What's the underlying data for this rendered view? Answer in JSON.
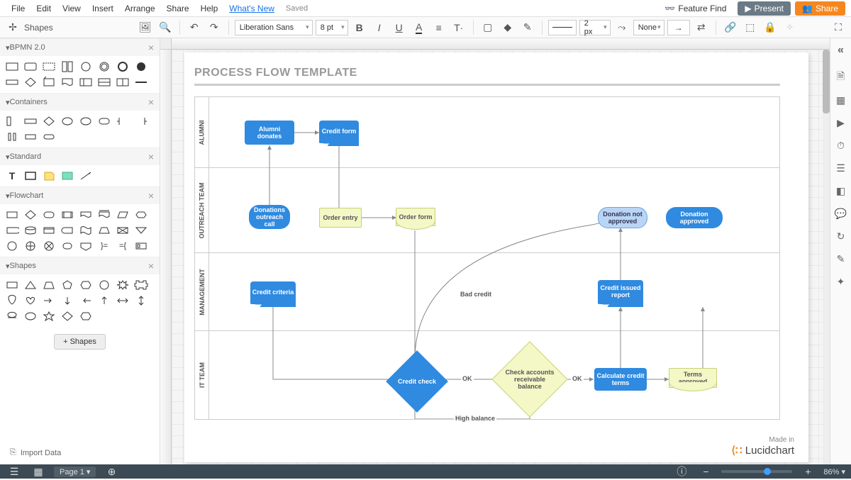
{
  "menubar": {
    "items": [
      "File",
      "Edit",
      "View",
      "Insert",
      "Arrange",
      "Share",
      "Help"
    ],
    "whats_new": "What's New",
    "saved": "Saved",
    "feature_find": "Feature Find",
    "present": "Present",
    "share": "Share"
  },
  "toolbar": {
    "font_family": "Liberation Sans",
    "font_size": "8 pt",
    "line_width": "2 px",
    "fill": "None"
  },
  "left_panel": {
    "header": "Shapes",
    "sections": {
      "bpmn": "BPMN 2.0",
      "containers": "Containers",
      "standard": "Standard",
      "flowchart": "Flowchart",
      "shapes": "Shapes"
    },
    "add_shapes": "+  Shapes",
    "import_data": "Import Data"
  },
  "diagram": {
    "title": "PROCESS FLOW TEMPLATE",
    "swimlanes": [
      "ALUMNI",
      "OUTREACH TEAM",
      "MANAGEMENT",
      "IT TEAM"
    ],
    "nodes": {
      "alumni_donates": "Alumni donates",
      "credit_form": "Credit form",
      "donations_outreach_call": "Donations outreach call",
      "order_entry": "Order entry",
      "order_form": "Order form",
      "donation_not_approved": "Donation not approved",
      "donation_approved": "Donation approved",
      "credit_criteria": "Credit criteria",
      "bad_credit": "Bad credit",
      "credit_issued_report": "Credit issued report",
      "credit_check": "Credit check",
      "check_accounts": "Check accounts receivable balance",
      "calculate_credit_terms": "Calculate credit terms",
      "terms_approved": "Terms approved"
    },
    "edge_labels": {
      "ok1": "OK",
      "ok2": "OK",
      "high_balance": "High balance"
    },
    "made_in": "Made in",
    "brand": "Lucidchart"
  },
  "bottom_bar": {
    "page_tab": "Page 1 ▾",
    "zoom": "86% ▾"
  },
  "chart_data": {
    "type": "swimlane-flowchart",
    "title": "PROCESS FLOW TEMPLATE",
    "lanes": [
      {
        "id": "alumni",
        "label": "ALUMNI"
      },
      {
        "id": "outreach",
        "label": "OUTREACH TEAM"
      },
      {
        "id": "management",
        "label": "MANAGEMENT"
      },
      {
        "id": "it",
        "label": "IT TEAM"
      }
    ],
    "nodes": [
      {
        "id": "alumni_donates",
        "lane": "alumni",
        "label": "Alumni donates",
        "shape": "process",
        "style": "blue"
      },
      {
        "id": "credit_form",
        "lane": "alumni",
        "label": "Credit form",
        "shape": "document",
        "style": "blue"
      },
      {
        "id": "donations_outreach_call",
        "lane": "outreach",
        "label": "Donations outreach call",
        "shape": "terminator",
        "style": "blue"
      },
      {
        "id": "order_entry",
        "lane": "outreach",
        "label": "Order entry",
        "shape": "process",
        "style": "yellow"
      },
      {
        "id": "order_form",
        "lane": "outreach",
        "label": "Order form",
        "shape": "document",
        "style": "yellow"
      },
      {
        "id": "donation_not_approved",
        "lane": "outreach",
        "label": "Donation not approved",
        "shape": "terminator",
        "style": "lightblue"
      },
      {
        "id": "donation_approved",
        "lane": "outreach",
        "label": "Donation approved",
        "shape": "terminator",
        "style": "blue"
      },
      {
        "id": "credit_criteria",
        "lane": "management",
        "label": "Credit criteria",
        "shape": "document",
        "style": "blue"
      },
      {
        "id": "credit_issued_report",
        "lane": "management",
        "label": "Credit issued report",
        "shape": "document",
        "style": "blue"
      },
      {
        "id": "credit_check",
        "lane": "it",
        "label": "Credit check",
        "shape": "decision",
        "style": "blue"
      },
      {
        "id": "check_accounts",
        "lane": "it",
        "label": "Check accounts receivable balance",
        "shape": "decision",
        "style": "yellow"
      },
      {
        "id": "calculate_credit_terms",
        "lane": "it",
        "label": "Calculate credit terms",
        "shape": "process",
        "style": "blue"
      },
      {
        "id": "terms_approved",
        "lane": "it",
        "label": "Terms approved",
        "shape": "document",
        "style": "yellow"
      }
    ],
    "edges": [
      {
        "from": "donations_outreach_call",
        "to": "alumni_donates"
      },
      {
        "from": "alumni_donates",
        "to": "credit_form"
      },
      {
        "from": "credit_form",
        "to": "order_entry"
      },
      {
        "from": "order_entry",
        "to": "order_form"
      },
      {
        "from": "order_form",
        "to": "credit_check"
      },
      {
        "from": "credit_criteria",
        "to": "credit_check"
      },
      {
        "from": "credit_check",
        "to": "check_accounts",
        "label": "OK"
      },
      {
        "from": "credit_check",
        "to": "donation_not_approved",
        "label": "Bad credit"
      },
      {
        "from": "check_accounts",
        "to": "calculate_credit_terms",
        "label": "OK"
      },
      {
        "from": "check_accounts",
        "to": "credit_check",
        "label": "High balance"
      },
      {
        "from": "calculate_credit_terms",
        "to": "terms_approved"
      },
      {
        "from": "calculate_credit_terms",
        "to": "credit_issued_report"
      },
      {
        "from": "terms_approved",
        "to": "donation_approved"
      },
      {
        "from": "credit_issued_report",
        "to": "donation_not_approved"
      }
    ]
  }
}
